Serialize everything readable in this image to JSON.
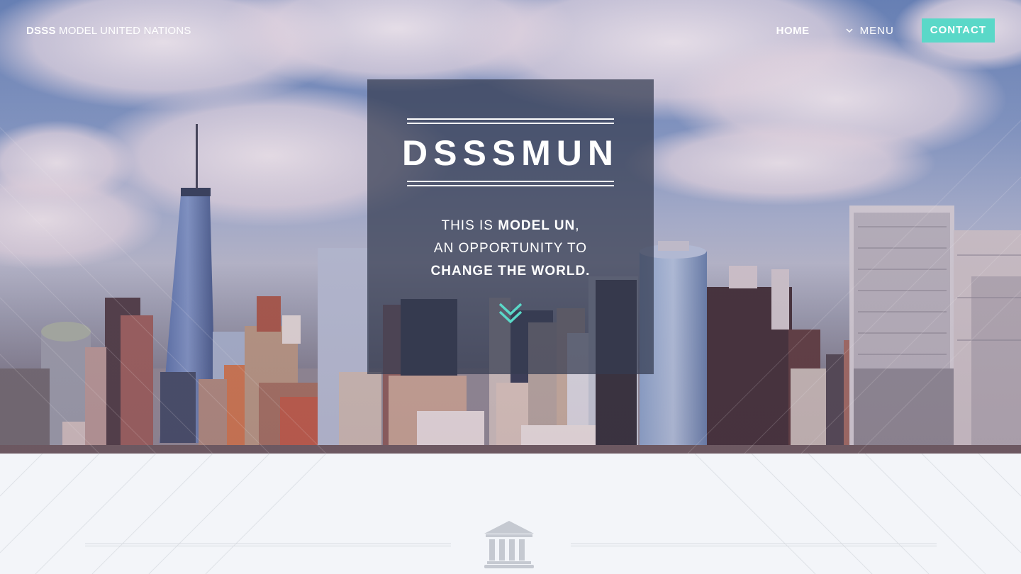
{
  "nav": {
    "brand_bold": "DSSS",
    "brand_rest": " MODEL UNITED NATIONS",
    "home_label": "HOME",
    "menu_label": "MENU",
    "contact_label": "CONTACT"
  },
  "hero": {
    "title": "DSSSMUN",
    "line1_prefix": "THIS IS ",
    "line1_bold": "MODEL UN",
    "line1_suffix": ",",
    "line2": "AN OPPORTUNITY TO",
    "line3_bold": "CHANGE THE WORLD.",
    "scroll_icon": "double-chevron-down-icon",
    "background_image": "city-skyline-photo"
  },
  "lower": {
    "icon": "institution-building-icon"
  },
  "colors": {
    "accent": "#5ad8c8",
    "box": "#343c50",
    "section_bg": "#f3f5f9",
    "icon_gray": "#c5c9d1"
  }
}
